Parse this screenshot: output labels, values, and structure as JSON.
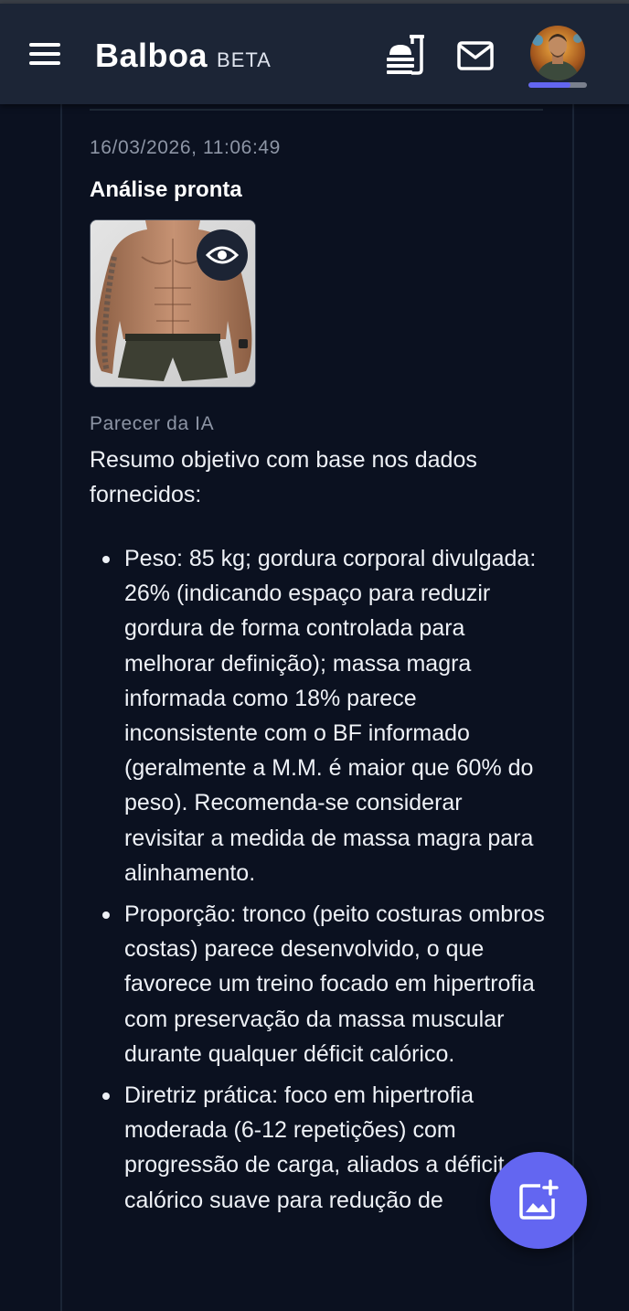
{
  "header": {
    "app_name": "Balboa",
    "badge": "BETA",
    "menu_icon": "hamburger-menu-icon",
    "meal_icon": "food-tray-icon",
    "mail_icon": "mail-icon",
    "avatar_progress": 0.72,
    "accent_color": "#6366f1"
  },
  "entry": {
    "timestamp": "16/03/2026, 11:06:49",
    "status": "Análise pronta",
    "view_icon": "eye-icon",
    "ai_label": "Parecer da IA",
    "intro": "Resumo objetivo com base nos dados fornecidos:",
    "bullets": [
      "Peso: 85 kg; gordura corporal divulgada: 26% (indicando espaço para reduzir gordura de forma controlada para melhorar definição); massa magra informada como 18% parece inconsistente com o BF informado (geralmente a M.M. é maior que 60% do peso). Recomenda-se considerar revisitar a medida de massa magra para alinhamento.",
      "Proporção: tronco (peito costuras ombros costas) parece desenvolvido, o que favorece um treino focado em hipertrofia com preservação da massa muscular durante qualquer déficit calórico.",
      "Diretriz prática: foco em hipertrofia moderada (6-12 repetições) com progressão de carga, aliados a déficit calórico suave para redução de"
    ]
  },
  "fab": {
    "icon": "add-photo-icon"
  }
}
